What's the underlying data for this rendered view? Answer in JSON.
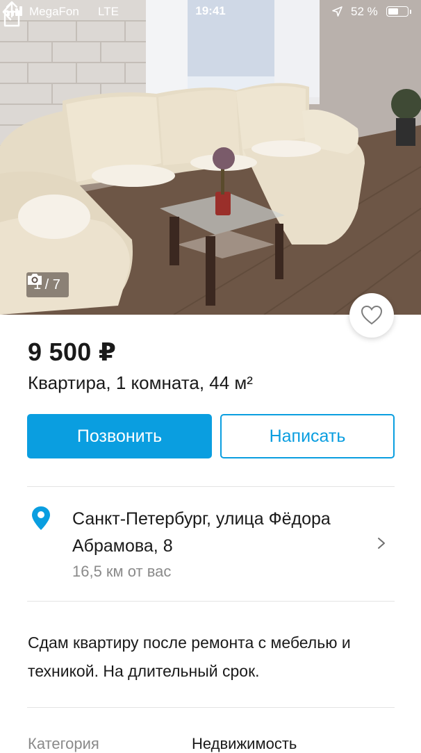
{
  "status_bar": {
    "carrier": "MegaFon",
    "network": "LTE",
    "time": "19:41",
    "battery": "52 %"
  },
  "photo": {
    "counter": "1 / 7"
  },
  "listing": {
    "price": "9 500 ₽",
    "subtitle": "Квартира, 1 комната, 44 м²"
  },
  "actions": {
    "call_label": "Позвонить",
    "write_label": "Написать"
  },
  "location": {
    "address": "Санкт-Петербург, улица Фёдора Абрамова, 8",
    "distance": "16,5  км от вас"
  },
  "description": "Сдам квартиру после ремонта с мебелью и техникой. На длительный срок.",
  "params": [
    {
      "label": "Категория",
      "value": "Недвижимость"
    }
  ],
  "colors": {
    "accent": "#0a9ee0",
    "text": "#1a1a1a",
    "secondary_text": "#8a8a8a"
  }
}
